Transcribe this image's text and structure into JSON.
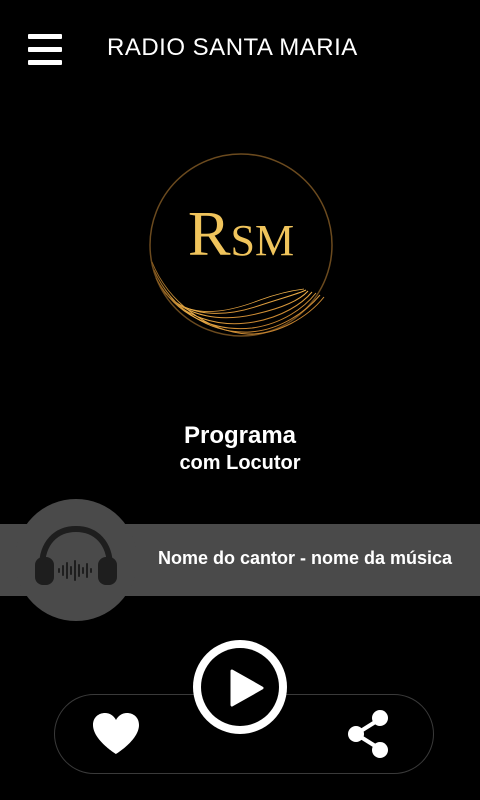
{
  "header": {
    "title": "RADIO SANTA MARIA",
    "menu_icon": "hamburger-menu-icon"
  },
  "logo": {
    "text": "RSM",
    "ring_color": "#c7913b",
    "text_color": "#f0c45c"
  },
  "program": {
    "title": "Programa",
    "host": "com Locutor"
  },
  "now_playing": {
    "track": "Nome do cantor - nome da música",
    "artwork_icon": "headphones-icon"
  },
  "controls": {
    "favorite_icon": "heart-icon",
    "play_icon": "play-icon",
    "share_icon": "share-icon"
  },
  "colors": {
    "background": "#000000",
    "track_bar": "#4a4a4a",
    "accent_gold": "#e0a94a"
  }
}
